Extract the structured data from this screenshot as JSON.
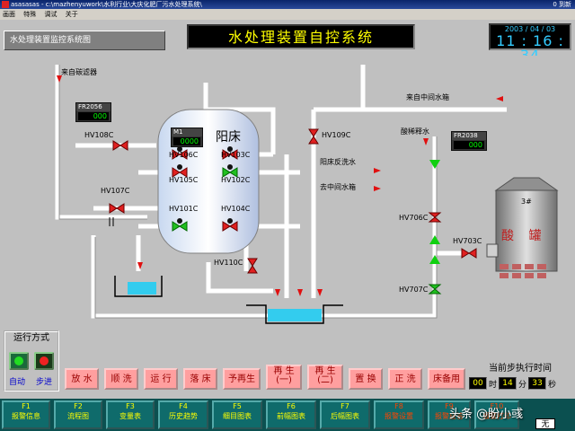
{
  "window": {
    "title": "asasasas - c:\\mazhenyuwork\\水利行业\\大庆化肥厂污水处理系统\\",
    "status": "0 到新"
  },
  "menu": [
    "画面",
    "特殊",
    "调试",
    "关于"
  ],
  "header": {
    "subtitle": "水处理装置监控系统图",
    "main_title": "水处理装置自控系统",
    "date": "2003 / 04 / 03",
    "time": "11 : 16 : 34"
  },
  "diagram": {
    "labels": {
      "from_carbon_filter": "来自碳滤器",
      "from_mid_tank": "来自中间水箱",
      "dilute_water": "酸稀释水",
      "backwash_water": "阳床反洗水",
      "to_mid_tank": "去中间水箱",
      "vessel_name": "阳床",
      "tank_number": "3#",
      "tank_name": "酸 罐"
    },
    "meters": [
      {
        "id": "FR2056",
        "value": "000"
      },
      {
        "id": "M1",
        "value": "0000"
      },
      {
        "id": "FR2038",
        "value": "000"
      }
    ],
    "valves": {
      "hv108c": "HV108C",
      "hv106c": "HV106C",
      "hv103c": "HV103C",
      "hv109c": "HV109C",
      "hv105c": "HV105C",
      "hv102c": "HV102C",
      "hv107c": "HV107C",
      "hv101c": "HV101C",
      "hv104c": "HV104C",
      "hv110c": "HV110C",
      "hv706c": "HV706C",
      "hv703c": "HV703C",
      "hv707c": "HV707C"
    }
  },
  "mode_panel": {
    "title": "运行方式",
    "auto": "自动",
    "step": "步进"
  },
  "steps": [
    {
      "label": "放 水"
    },
    {
      "label": "顺 洗"
    },
    {
      "label": "运 行"
    },
    {
      "label": "落 床"
    },
    {
      "label": "予再生"
    },
    {
      "label": "再 生\n(一)"
    },
    {
      "label": "再 生\n(二)"
    },
    {
      "label": "置 换"
    },
    {
      "label": "正 洗"
    },
    {
      "label": "床备用"
    }
  ],
  "step_time": {
    "title": "当前步执行时间",
    "h": "00",
    "h_unit": "时",
    "m": "14",
    "m_unit": "分",
    "s": "33",
    "s_unit": "秒"
  },
  "fkeys": [
    {
      "key": "F1",
      "label": "报警信息"
    },
    {
      "key": "F2",
      "label": "流程图"
    },
    {
      "key": "F3",
      "label": "变量表"
    },
    {
      "key": "F4",
      "label": "历史趋势"
    },
    {
      "key": "F5",
      "label": "细目图表"
    },
    {
      "key": "F6",
      "label": "前幅图表"
    },
    {
      "key": "F7",
      "label": "后幅图表"
    },
    {
      "key": "F8",
      "label": "报警设置"
    },
    {
      "key": "F9",
      "label": "报警应答"
    },
    {
      "key": "F10",
      "label": "报警打印"
    }
  ],
  "watermark": "头条 @盼小彧",
  "status_box": "无"
}
